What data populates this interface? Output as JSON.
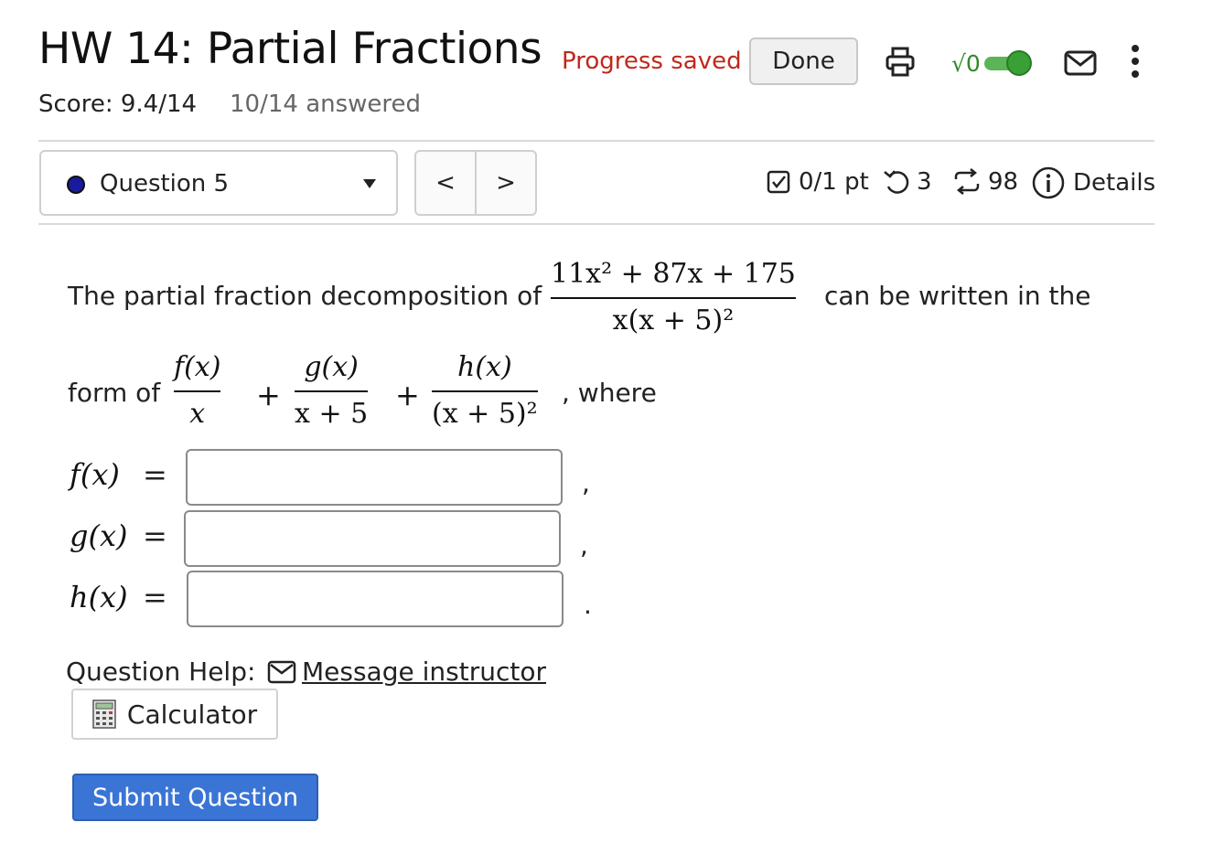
{
  "header": {
    "title": "HW 14: Partial Fractions",
    "progress_status": "Progress saved",
    "done_label": "Done",
    "sqrt_toggle_label": "√0",
    "icons": [
      "printer-icon",
      "math-entry-toggle-icon",
      "mail-icon",
      "more-vertical-icon"
    ],
    "score": "Score: 9.4/14",
    "answered": "10/14 answered"
  },
  "question_nav": {
    "selected_question": "Question 5",
    "prev_label": "<",
    "next_label": ">"
  },
  "question_meta": {
    "points": "0/1 pt",
    "attempts_remaining": "3",
    "versions": "98",
    "details_label": "Details"
  },
  "problem": {
    "intro": "The partial fraction decomposition of",
    "main_numerator": "11x² + 87x + 175",
    "main_denominator": "x(x + 5)²",
    "after_fraction": "can be written in the",
    "form_prefix": "form of",
    "term1_num": "f(x)",
    "term1_den": "x",
    "term2_num": "g(x)",
    "term2_den": "x + 5",
    "term3_num": "h(x)",
    "term3_den": "(x + 5)²",
    "plus": "+",
    "where": ", where",
    "answers": [
      {
        "label": "f(x)",
        "equals": "=",
        "value": "",
        "after": ","
      },
      {
        "label": "g(x)",
        "equals": "=",
        "value": "",
        "after": ","
      },
      {
        "label": "h(x)",
        "equals": "=",
        "value": "",
        "after": "."
      }
    ]
  },
  "help": {
    "label": "Question Help:",
    "message_link": "Message instructor",
    "calculator_label": "Calculator"
  },
  "submit_label": "Submit Question",
  "colors": {
    "accent_blue": "#3a75d6",
    "saved_red": "#c0281b",
    "toggle_green": "#3aa035",
    "question_dot": "#1a1a9e"
  }
}
